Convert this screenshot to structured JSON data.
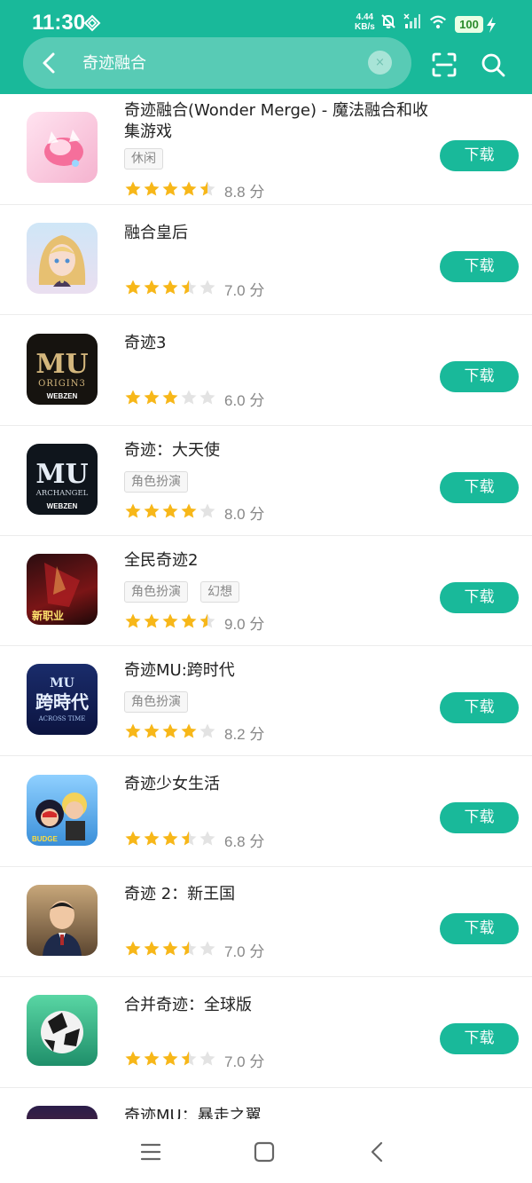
{
  "status": {
    "time": "11:30",
    "net_speed": "4.44",
    "net_unit": "KB/s",
    "battery": "100"
  },
  "search": {
    "query": "奇迹融合",
    "clear": "×"
  },
  "download_label": "下载",
  "rating_unit": "分",
  "items": [
    {
      "title": "奇迹融合(Wonder Merge) - 魔法融合和收集游戏",
      "tags": [
        "休闲"
      ],
      "score": "8.8",
      "stars": [
        1,
        1,
        1,
        1,
        0.5
      ]
    },
    {
      "title": "融合皇后",
      "tags": [],
      "score": "7.0",
      "stars": [
        1,
        1,
        1,
        0.5,
        0
      ]
    },
    {
      "title": "奇迹3",
      "tags": [],
      "score": "6.0",
      "stars": [
        1,
        1,
        1,
        0,
        0
      ],
      "icon_text_1": "MU",
      "icon_text_2": "ORIGIN3",
      "icon_text_3": "WEBZEN"
    },
    {
      "title": "奇迹：大天使",
      "tags": [
        "角色扮演"
      ],
      "score": "8.0",
      "stars": [
        1,
        1,
        1,
        1,
        0
      ],
      "icon_text_1": "MU",
      "icon_text_2": "ARCHANGEL",
      "icon_text_3": "WEBZEN"
    },
    {
      "title": "全民奇迹2",
      "tags": [
        "角色扮演",
        "幻想"
      ],
      "score": "9.0",
      "stars": [
        1,
        1,
        1,
        1,
        0.5
      ],
      "icon_text_1": "新职业"
    },
    {
      "title": "奇迹MU:跨时代",
      "tags": [
        "角色扮演"
      ],
      "score": "8.2",
      "stars": [
        1,
        1,
        1,
        1,
        0
      ],
      "icon_text_1": "MU",
      "icon_text_2": "跨時代",
      "icon_text_3": "ACROSS TIME"
    },
    {
      "title": "奇迹少女生活",
      "tags": [],
      "score": "6.8",
      "stars": [
        1,
        1,
        1,
        0.5,
        0
      ],
      "icon_text_1": "BUDGE"
    },
    {
      "title": "奇迹 2：新王国",
      "tags": [],
      "score": "7.0",
      "stars": [
        1,
        1,
        1,
        0.5,
        0
      ]
    },
    {
      "title": "合并奇迹：全球版",
      "tags": [],
      "score": "7.0",
      "stars": [
        1,
        1,
        1,
        0.5,
        0
      ]
    },
    {
      "title": "奇迹MU：暴走之翼",
      "tags": [],
      "score": "",
      "stars": []
    }
  ],
  "colors": {
    "brand": "#19b99a",
    "star": "#f7b719",
    "star_empty": "#e3e3e3"
  }
}
